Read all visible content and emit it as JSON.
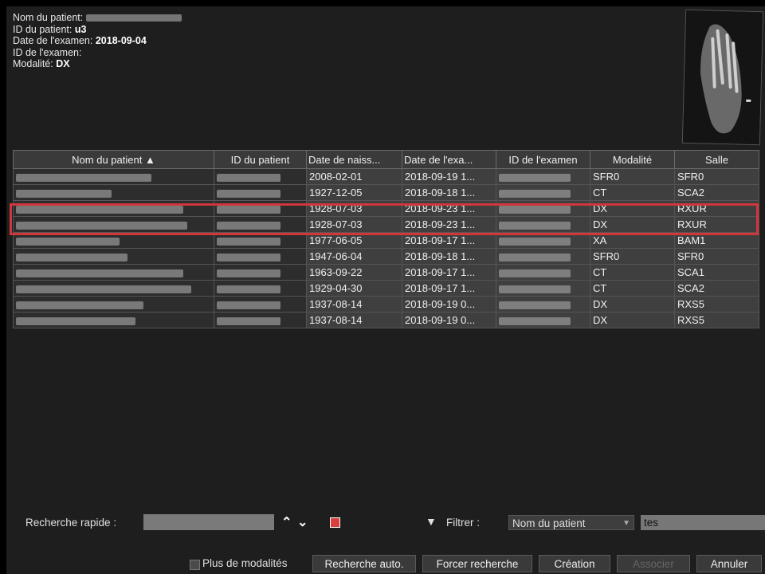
{
  "header": {
    "patient_name_label": "Nom du patient:",
    "patient_id_label": "ID du patient:",
    "patient_id_value": "u3",
    "exam_date_label": "Date de l'examen:",
    "exam_date_value": "2018-09-04",
    "exam_id_label": "ID de l'examen:",
    "modality_label": "Modalité:",
    "modality_value": "DX"
  },
  "table": {
    "columns": [
      "Nom du patient ▲",
      "ID du patient",
      "Date de naiss...",
      "Date de l'exa...",
      "ID de l'examen",
      "Modalité",
      "Salle"
    ],
    "rows": [
      {
        "birth": "2008-02-01",
        "exam_date": "2018-09-19 1...",
        "modality": "SFR0",
        "room": "SFR0"
      },
      {
        "birth": "1927-12-05",
        "exam_date": "2018-09-18 1...",
        "modality": "CT",
        "room": "SCA2"
      },
      {
        "birth": "1928-07-03",
        "exam_date": "2018-09-23 1...",
        "modality": "DX",
        "room": "RXUR"
      },
      {
        "birth": "1928-07-03",
        "exam_date": "2018-09-23 1...",
        "modality": "DX",
        "room": "RXUR"
      },
      {
        "birth": "1977-06-05",
        "exam_date": "2018-09-17 1...",
        "modality": "XA",
        "room": "BAM1"
      },
      {
        "birth": "1947-06-04",
        "exam_date": "2018-09-18 1...",
        "modality": "SFR0",
        "room": "SFR0"
      },
      {
        "birth": "1963-09-22",
        "exam_date": "2018-09-17 1...",
        "modality": "CT",
        "room": "SCA1"
      },
      {
        "birth": "1929-04-30",
        "exam_date": "2018-09-17 1...",
        "modality": "CT",
        "room": "SCA2"
      },
      {
        "birth": "1937-08-14",
        "exam_date": "2018-09-19 0...",
        "modality": "DX",
        "room": "RXS5"
      },
      {
        "birth": "1937-08-14",
        "exam_date": "2018-09-19 0...",
        "modality": "DX",
        "room": "RXS5"
      }
    ]
  },
  "search": {
    "quick_label": "Recherche rapide :",
    "filter_label": "Filtrer :",
    "filter_field": "Nom du patient",
    "filter_value": "tes"
  },
  "buttons": {
    "more_modalities": "Plus de modalités",
    "auto_search": "Recherche auto.",
    "force_search": "Forcer recherche",
    "create": "Création",
    "associate": "Associer",
    "cancel": "Annuler"
  },
  "colors": {
    "highlight": "#d0363c",
    "background": "#1e1e1e"
  }
}
